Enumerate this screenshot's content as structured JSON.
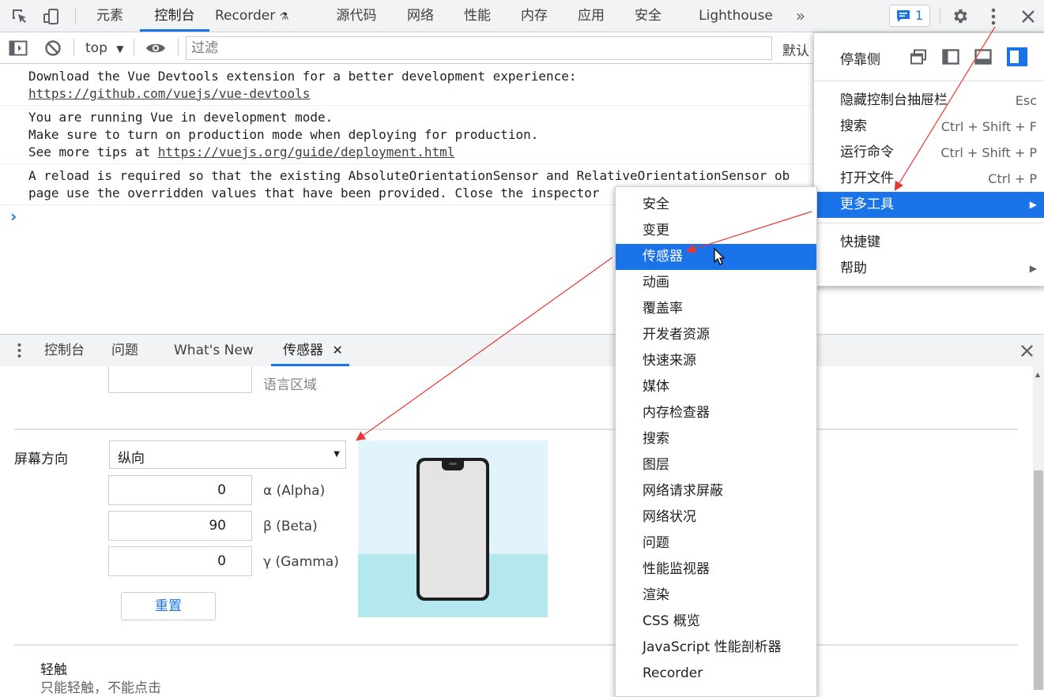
{
  "main_tabs": [
    "元素",
    "控制台",
    "Recorder",
    "源代码",
    "网络",
    "性能",
    "内存",
    "应用",
    "安全",
    "Lighthouse"
  ],
  "issues_badge": "1",
  "console_toolbar": {
    "context": "top",
    "filter_placeholder": "过滤",
    "levels_label": "默认"
  },
  "messages": {
    "m1_l1": "Download the Vue Devtools extension for a better development experience:",
    "m1_link": "https://github.com/vuejs/vue-devtools",
    "m2_l1": "You are running Vue in development mode.",
    "m2_l2": "Make sure to turn on production mode when deploying for production.",
    "m2_l3_prefix": "See more tips at ",
    "m2_link": "https://vuejs.org/guide/deployment.html",
    "m3_l1": "A reload is required so that the existing AbsoluteOrientationSensor and RelativeOrientationSensor ob",
    "m3_l2": "page use the overridden values that have been provided. Close the inspector"
  },
  "prompt": "›",
  "drawer_tabs": [
    "控制台",
    "问题",
    "What's New",
    "传感器"
  ],
  "sensors": {
    "locale_label": "语言区域",
    "orientation_label": "屏幕方向",
    "orientation_value": "纵向",
    "alpha_value": "0",
    "alpha_label": "α (Alpha)",
    "beta_value": "90",
    "beta_label": "β (Beta)",
    "gamma_value": "0",
    "gamma_label": "γ (Gamma)",
    "reset_label": "重置",
    "touch_title": "轻触",
    "touch_desc": "只能轻触，不能点击"
  },
  "main_menu": {
    "dock_label": "停靠侧",
    "items": [
      {
        "label": "隐藏控制台抽屉栏",
        "shortcut": "Esc"
      },
      {
        "label": "搜索",
        "shortcut": "Ctrl + Shift + F"
      },
      {
        "label": "运行命令",
        "shortcut": "Ctrl + Shift + P"
      },
      {
        "label": "打开文件",
        "shortcut": "Ctrl + P"
      },
      {
        "label": "更多工具",
        "shortcut": ""
      },
      {
        "label": "快捷键",
        "shortcut": ""
      },
      {
        "label": "帮助",
        "shortcut": ""
      }
    ]
  },
  "more_tools": [
    "安全",
    "变更",
    "传感器",
    "动画",
    "覆盖率",
    "开发者资源",
    "快速来源",
    "媒体",
    "内存检查器",
    "搜索",
    "图层",
    "网络请求屏蔽",
    "网络状况",
    "问题",
    "性能监视器",
    "渲染",
    "CSS 概览",
    "JavaScript 性能剖析器",
    "Recorder"
  ],
  "colors": {
    "accent": "#1a73e8",
    "arrow": "#e53935",
    "phone_sky": "#e1f3fb",
    "phone_sea": "#b3e8ee"
  }
}
